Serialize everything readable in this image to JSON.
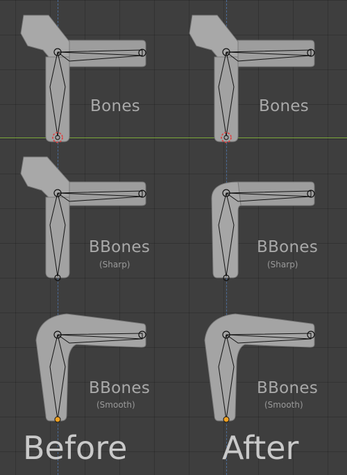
{
  "captions": {
    "before": "Before",
    "after": "After"
  },
  "rows": [
    {
      "title": "Bones",
      "subtitle": ""
    },
    {
      "title": "BBones",
      "subtitle": "(Sharp)"
    },
    {
      "title": "BBones",
      "subtitle": "(Smooth)"
    }
  ],
  "colors": {
    "background": "#3e3e3e",
    "grid": "#2e2e2e",
    "x_axis": "#7aa83a",
    "z_axis": "#4d74a8",
    "mesh": "#9a9a9a",
    "bone_outline": "#111111",
    "pivot_red": "#e04040",
    "pivot_orange": "#f0a020"
  }
}
